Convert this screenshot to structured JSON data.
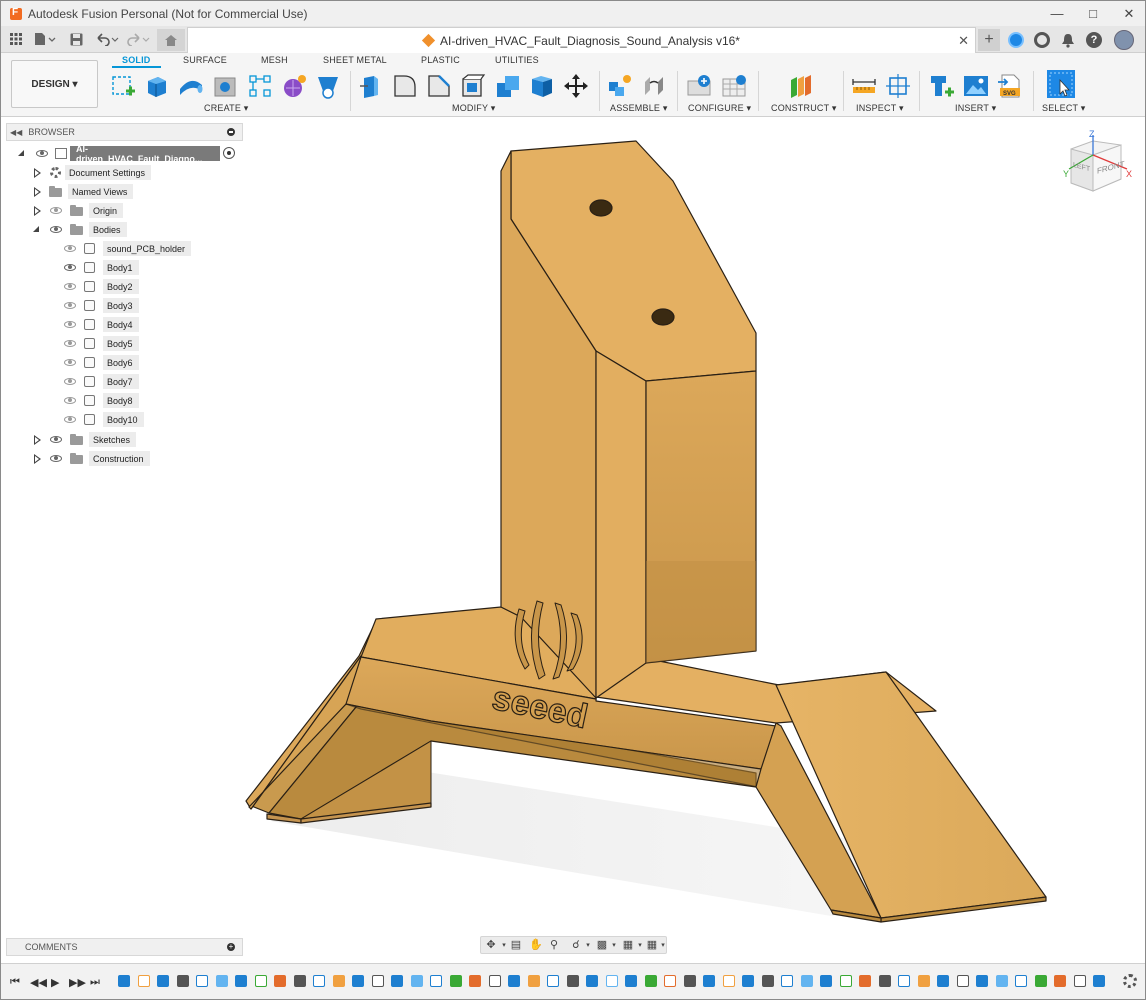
{
  "window": {
    "title": "Autodesk Fusion Personal (Not for Commercial Use)"
  },
  "tabbar": {
    "document_tab": "AI-driven_HVAC_Fault_Diagnosis_Sound_Analysis v16*"
  },
  "toolbar": {
    "workspace_button": "DESIGN ▾",
    "mode_tabs": [
      "SOLID",
      "SURFACE",
      "MESH",
      "SHEET METAL",
      "PLASTIC",
      "UTILITIES"
    ],
    "active_mode": "SOLID",
    "groups": [
      "CREATE ▾",
      "MODIFY ▾",
      "ASSEMBLE ▾",
      "CONFIGURE ▾",
      "CONSTRUCT ▾",
      "INSPECT ▾",
      "INSERT ▾",
      "SELECT ▾"
    ]
  },
  "browser": {
    "header": "BROWSER",
    "root": "AI-driven_HVAC_Fault_Diagno...",
    "items": {
      "document_settings": "Document Settings",
      "named_views": "Named Views",
      "origin": "Origin",
      "bodies": "Bodies",
      "sketches": "Sketches",
      "construction": "Construction"
    },
    "bodies": [
      "sound_PCB_holder",
      "Body1",
      "Body2",
      "Body3",
      "Body4",
      "Body5",
      "Body6",
      "Body7",
      "Body8",
      "Body10"
    ]
  },
  "comments": {
    "label": "COMMENTS"
  },
  "viewcube": {
    "faces": {
      "left": "LEFT",
      "front": "FRONT"
    },
    "axes": {
      "z": "Z",
      "x": "X",
      "y": "Y"
    }
  },
  "model": {
    "embossed_text": "seeed"
  },
  "colors": {
    "accent": "#0696d7",
    "model_face_light": "#e4b060",
    "model_face_mid": "#d8a455",
    "model_face_dark": "#b88838",
    "model_edge": "#2a2015",
    "root_pill": "#7a7a7a"
  }
}
